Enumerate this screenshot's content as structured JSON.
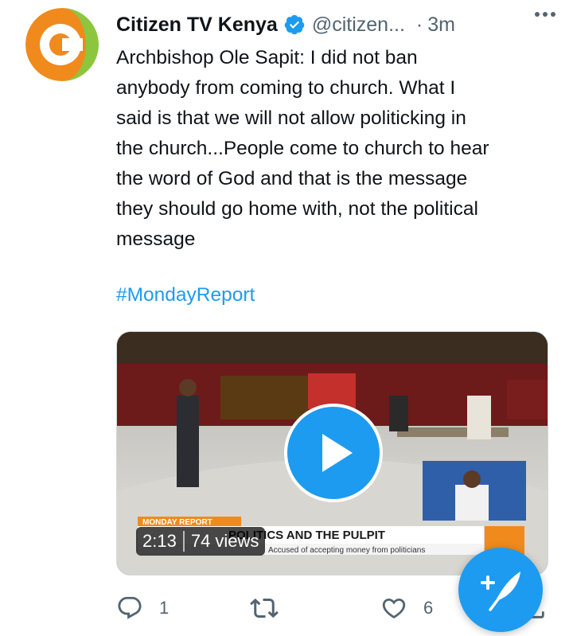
{
  "tweet": {
    "author_name": "Citizen TV Kenya",
    "handle": "@citizen...",
    "separator": "·",
    "time": "3m",
    "text": "Archbishop Ole Sapit: I did not ban\nanybody from coming to church. What I\nsaid is that we will not allow politicking in\nthe church...People come to church to hear\nthe word of God and that is the message\nthey should go home with, not the political\nmessage",
    "hashtag": "#MondayReport"
  },
  "video": {
    "duration": "2:13",
    "views": "74 views",
    "banner_tag": "MONDAY REPORT",
    "banner_title": "POLITICS AND THE PULPIT",
    "banner_sub": "Accused of accepting money from politicians"
  },
  "actions": {
    "reply_count": "1",
    "retweet_count": "",
    "like_count": "6"
  },
  "colors": {
    "accent": "#1d9bf0",
    "secondary_text": "#536471",
    "brand_orange": "#f08a1d",
    "brand_green": "#8cc63f"
  },
  "icons": {
    "verified": "verified-badge-icon",
    "more": "more-icon",
    "reply": "reply-icon",
    "retweet": "retweet-icon",
    "like": "heart-icon",
    "share": "share-icon",
    "compose": "compose-tweet-icon",
    "play": "play-icon"
  }
}
